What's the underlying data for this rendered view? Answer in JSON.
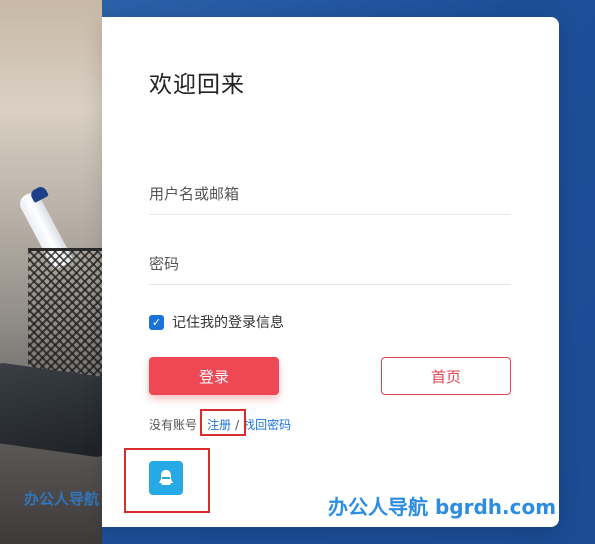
{
  "login": {
    "title": "欢迎回来",
    "username_placeholder": "用户名或邮箱",
    "password_placeholder": "密码",
    "remember_label": "记住我的登录信息",
    "remember_checked": true,
    "login_button": "登录",
    "home_button": "首页",
    "no_account_text": "没有账号",
    "register_link": "注册",
    "separator": "/",
    "forgot_link": "找回密码"
  },
  "social": {
    "qq_icon": "qq-penguin-icon"
  },
  "watermark": {
    "left": "办公人导航",
    "right": "办公人导航 bgrdh.com"
  },
  "colors": {
    "accent": "#ef4854",
    "link": "#1a73d9",
    "qq": "#26a9e4",
    "highlight": "#d92c2c"
  }
}
